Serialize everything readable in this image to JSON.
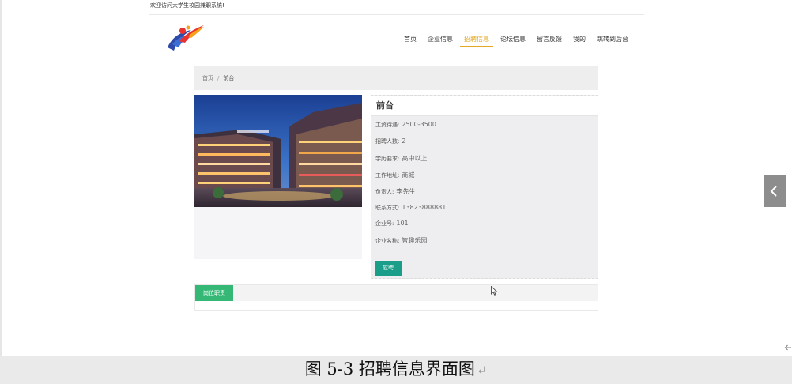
{
  "header": {
    "welcome_text": "欢迎访问大学生校园兼职系统!",
    "nav": [
      {
        "label": "首页",
        "active": false
      },
      {
        "label": "企业信息",
        "active": false
      },
      {
        "label": "招聘信息",
        "active": true
      },
      {
        "label": "论坛信息",
        "active": false
      },
      {
        "label": "留言反馈",
        "active": false
      },
      {
        "label": "我的",
        "active": false
      },
      {
        "label": "跳转到后台",
        "active": false
      }
    ]
  },
  "breadcrumb": {
    "home": "首页",
    "separator": "/",
    "current": "前台"
  },
  "job": {
    "title": "前台",
    "fields": [
      {
        "label": "工资待遇:",
        "value": "2500-3500"
      },
      {
        "label": "招聘人数:",
        "value": "2"
      },
      {
        "label": "学历要求:",
        "value": "高中以上"
      },
      {
        "label": "工作地址:",
        "value": "商城"
      },
      {
        "label": "负责人:",
        "value": "李先生"
      },
      {
        "label": "联系方式:",
        "value": "13823888881"
      },
      {
        "label": "企业号:",
        "value": "101"
      },
      {
        "label": "企业名称:",
        "value": "智趣乐园"
      }
    ],
    "apply_label": "应聘"
  },
  "duties": {
    "tab_label": "岗位职责"
  },
  "caption": {
    "text": "图 5-3 招聘信息界面图",
    "return_mark": "↵"
  },
  "colors": {
    "accent": "#e5a823",
    "button": "#1a9e8a",
    "tab": "#35b876",
    "side_arrow": "#8d8d8d"
  },
  "icons": {
    "side_arrow": "chevron-left-icon",
    "cursor": "mouse-pointer-icon",
    "back": "arrow-left-icon"
  }
}
